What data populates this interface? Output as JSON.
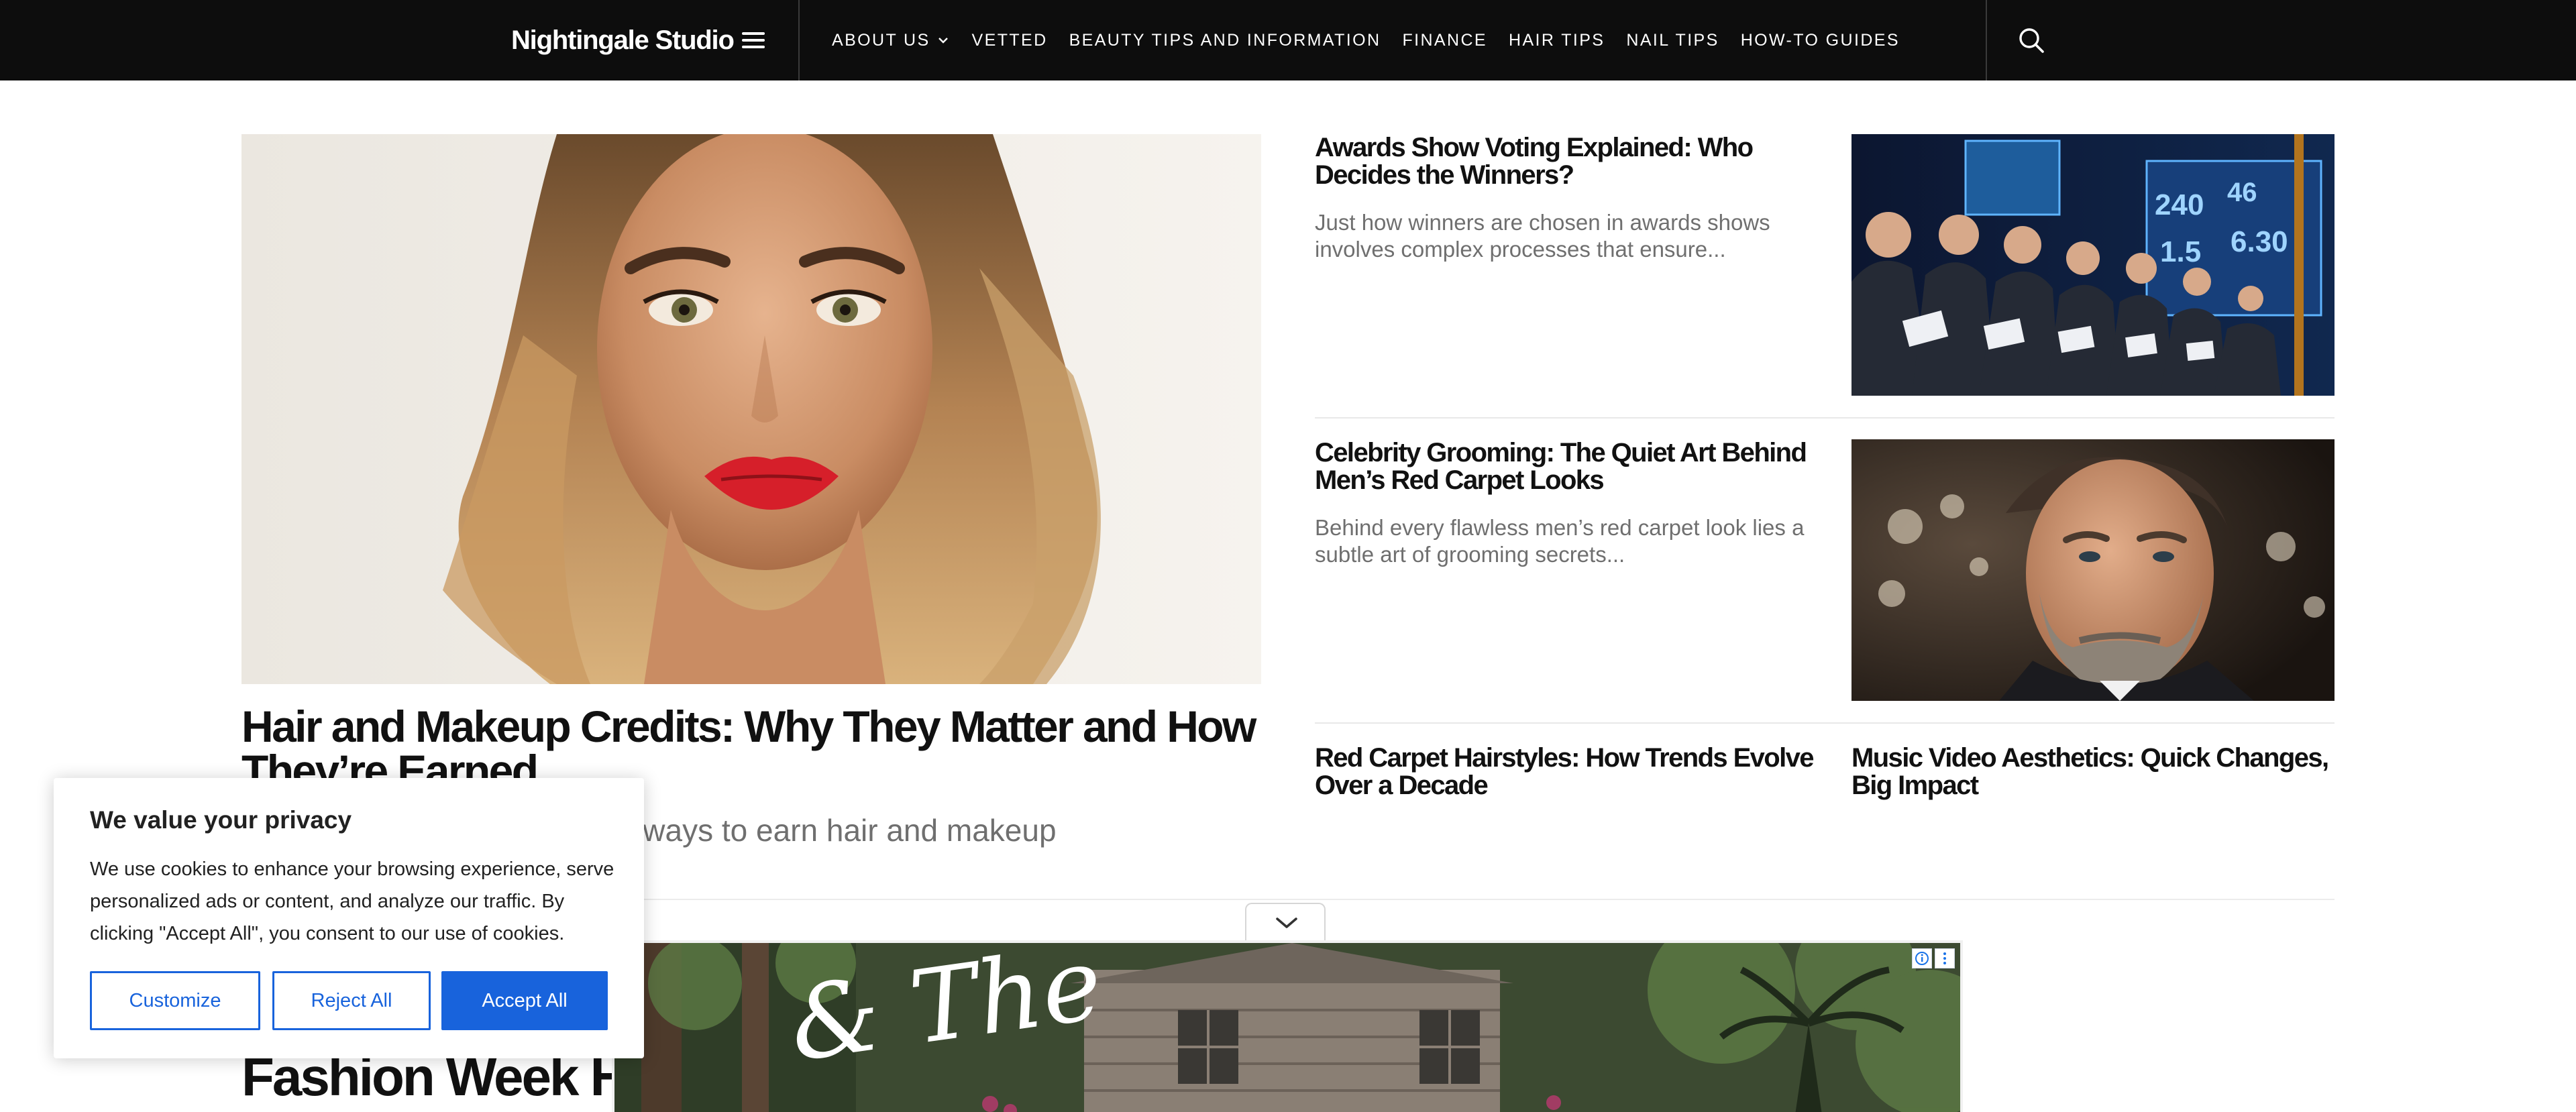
{
  "header": {
    "brand": "Nightingale Studio",
    "nav": [
      {
        "label": "ABOUT US",
        "has_dropdown": true
      },
      {
        "label": "VETTED"
      },
      {
        "label": "BEAUTY TIPS AND INFORMATION"
      },
      {
        "label": "FINANCE"
      },
      {
        "label": "HAIR TIPS"
      },
      {
        "label": "NAIL TIPS"
      },
      {
        "label": "HOW-TO GUIDES"
      }
    ]
  },
  "lead": {
    "title": "Hair and Makeup Credits: Why They Matter and How They’re Earned",
    "excerpt": "Discover the importance and ways to earn hair and makeup"
  },
  "side": [
    {
      "title": "Awards Show Voting Explained: Who Decides the Winners?",
      "excerpt": "Just how winners are chosen in awards shows involves complex processes that ensure..."
    },
    {
      "title": "Celebrity Grooming: The Quiet Art Behind Men’s Red Carpet Looks",
      "excerpt": "Behind every flawless men’s red carpet look lies a subtle art of grooming secrets..."
    },
    {
      "title": "Red Carpet Hairstyles: How Trends Evolve Over a Decade"
    },
    {
      "title": "Music Video Aesthetics: Quick Changes, Big Impact"
    }
  ],
  "next_section_title": "Fashion Week Hair",
  "ad": {
    "script_text": "& The"
  },
  "cookie": {
    "title": "We value your privacy",
    "text": "We use cookies to enhance your browsing experience, serve personalized ads or content, and analyze our traffic. By clicking \"Accept All\", you consent to our use of cookies.",
    "buttons": {
      "customize": "Customize",
      "reject": "Reject All",
      "accept": "Accept All"
    }
  },
  "colors": {
    "header_bg": "#0d0d0d",
    "accent": "#1863dc",
    "excerpt": "#6f6f6f"
  }
}
